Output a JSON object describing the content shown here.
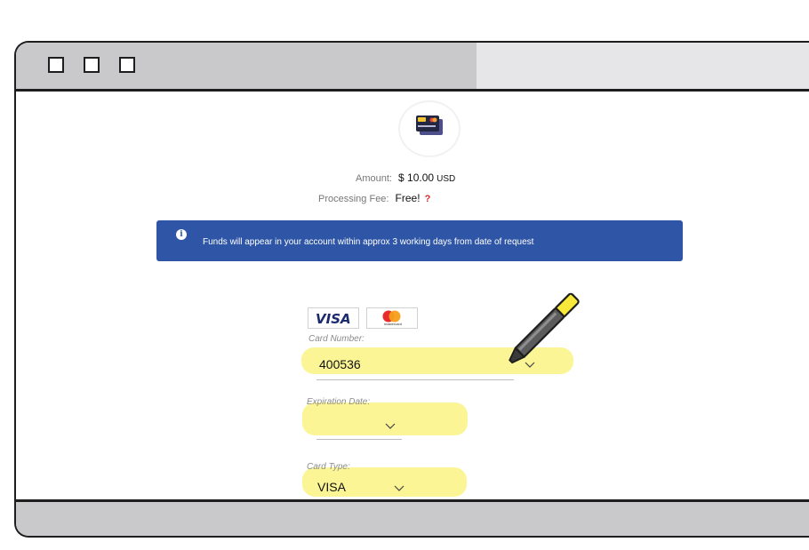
{
  "window": {
    "buttons": [
      "minimize",
      "maximize",
      "close"
    ]
  },
  "payment": {
    "amount_label": "Amount:",
    "amount_value": "$ 10.00",
    "amount_currency": "USD",
    "fee_label": "Processing Fee:",
    "fee_value": "Free!",
    "fee_help": "?"
  },
  "banner": {
    "icon": "info-icon",
    "message": "Funds will appear in your account within approx 3 working days from date of request",
    "color": "#2f56a6"
  },
  "cards": {
    "visa_label": "VISA",
    "mastercard_label": "mastercard"
  },
  "form": {
    "card_number_label": "Card Number:",
    "card_number_value": "400536",
    "expiration_label": "Expiration Date:",
    "expiration_value": "",
    "card_type_label": "Card Type:",
    "card_type_value": "VISA"
  },
  "colors": {
    "highlight": "#fbf48a",
    "accent": "#2f56a6"
  }
}
